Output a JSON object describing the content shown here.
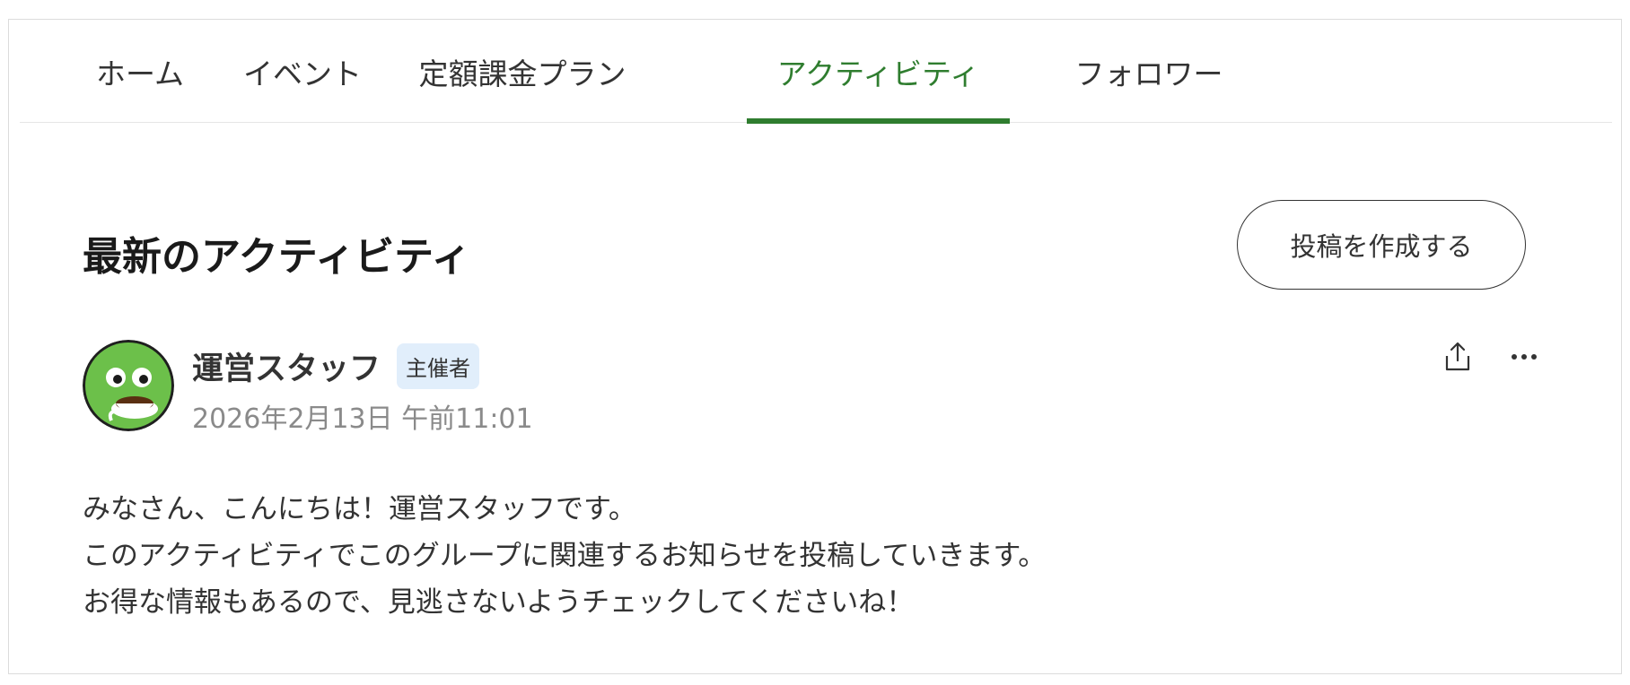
{
  "tabs": [
    {
      "label": "ホーム",
      "active": false
    },
    {
      "label": "イベント",
      "active": false
    },
    {
      "label": "定額課金プラン",
      "active": false
    },
    {
      "label": "アクティビティ",
      "active": true
    },
    {
      "label": "フォロワー",
      "active": false
    }
  ],
  "section": {
    "title": "最新のアクティビティ",
    "create_button": "投稿を作成する"
  },
  "post": {
    "author": "運営スタッフ",
    "badge": "主催者",
    "timestamp": "2026年2月13日 午前11:01",
    "body_lines": [
      "みなさん、こんにちは！運営スタッフです。",
      "このアクティビティでこのグループに関連するお知らせを投稿していきます。",
      "お得な情報もあるので、見逃さないようチェックしてくださいね！"
    ],
    "icons": {
      "share": "share-icon",
      "more": "more-icon"
    }
  },
  "colors": {
    "accent": "#2f7d2f",
    "badge_bg": "#e1eefb",
    "avatar_green": "#6cc04a"
  }
}
